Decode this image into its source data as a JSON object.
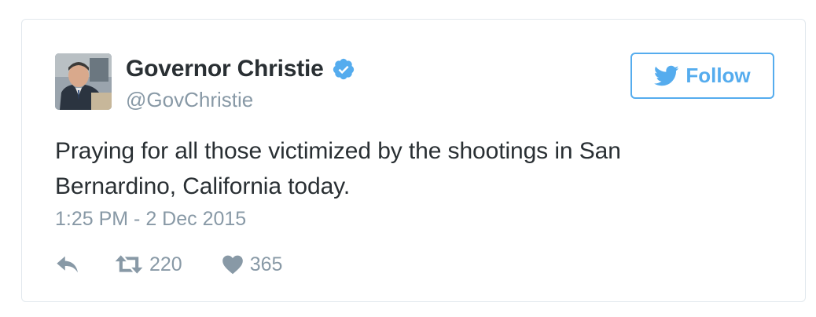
{
  "tweet": {
    "author_name": "Governor Christie",
    "author_handle": "@GovChristie",
    "follow_label": "Follow",
    "text": "Praying for all those victimized by the shootings in San Bernardino, California today.",
    "text_line1": "Praying for all those victimized by the shootings in San",
    "text_line2": "Bernardino, California today.",
    "timestamp": "1:25 PM - 2 Dec 2015",
    "retweet_count": "220",
    "like_count": "365"
  },
  "icons": {
    "verified": "verified-badge-icon",
    "follow": "twitter-bird-icon",
    "reply": "reply-icon",
    "retweet": "retweet-icon",
    "like": "heart-icon"
  },
  "colors": {
    "accent": "#55acee",
    "text": "#292f33",
    "muted": "#8899a6",
    "border": "#e1e8ed",
    "verified": "#55acee"
  }
}
